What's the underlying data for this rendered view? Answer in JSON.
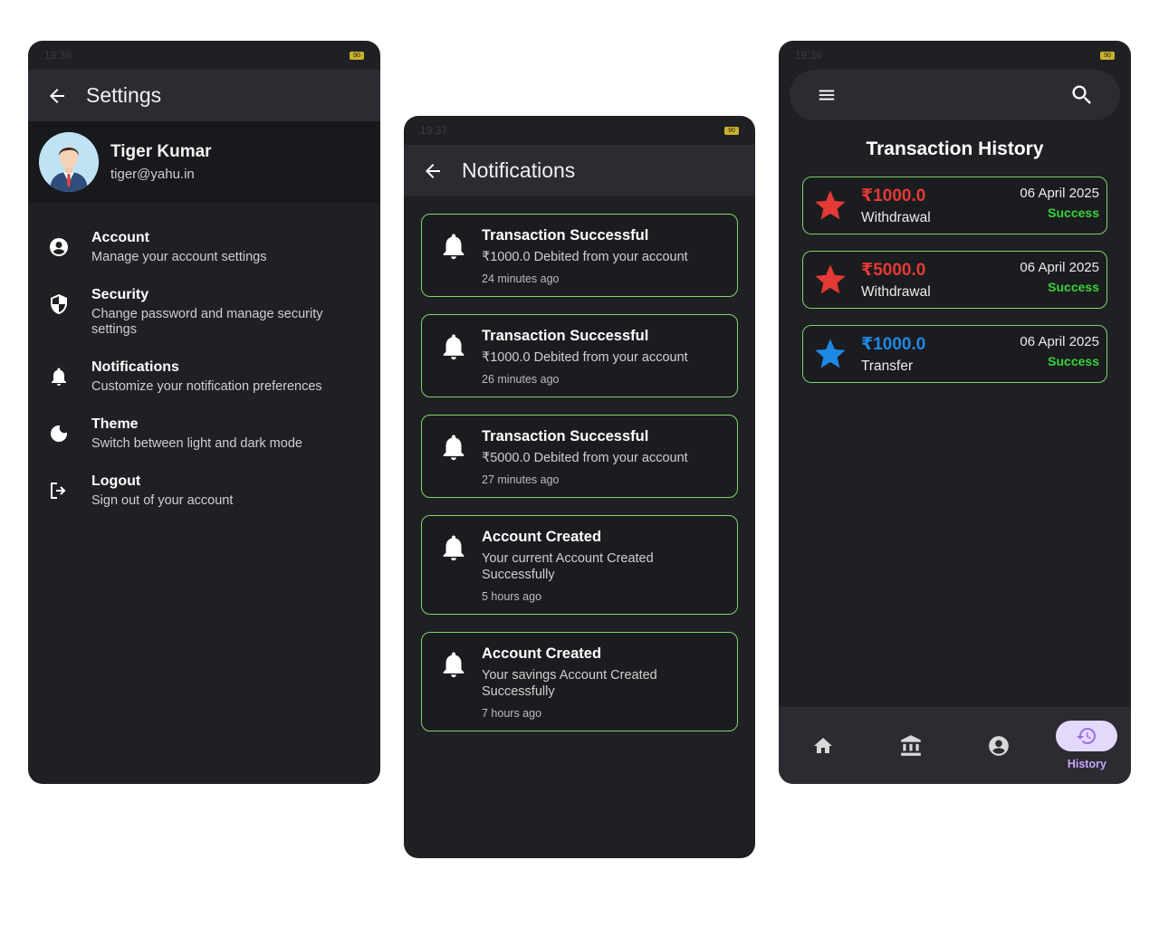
{
  "settings_screen": {
    "status": {
      "time": "19:36",
      "battery": "90"
    },
    "appbar_title": "Settings",
    "profile": {
      "name": "Tiger Kumar",
      "email": "tiger@yahu.in"
    },
    "items": [
      {
        "title": "Account",
        "subtitle": "Manage your account settings",
        "icon": "account-circle-icon"
      },
      {
        "title": "Security",
        "subtitle": "Change password and manage security settings",
        "icon": "shield-icon"
      },
      {
        "title": "Notifications",
        "subtitle": "Customize your notification preferences",
        "icon": "bell-icon"
      },
      {
        "title": "Theme",
        "subtitle": "Switch between light and dark mode",
        "icon": "moon-icon"
      },
      {
        "title": "Logout",
        "subtitle": "Sign out of your account",
        "icon": "logout-icon"
      }
    ]
  },
  "notifications_screen": {
    "status": {
      "time": "19:37",
      "battery": "90"
    },
    "appbar_title": "Notifications",
    "items": [
      {
        "title": "Transaction Successful",
        "message": "₹1000.0 Debited from your account",
        "time": "24 minutes ago"
      },
      {
        "title": "Transaction Successful",
        "message": "₹1000.0 Debited from your account",
        "time": "26 minutes ago"
      },
      {
        "title": "Transaction Successful",
        "message": "₹5000.0 Debited from your account",
        "time": "27 minutes ago"
      },
      {
        "title": "Account Created",
        "message": "Your current Account Created Successfully",
        "time": "5 hours ago"
      },
      {
        "title": "Account Created",
        "message": "Your savings Account Created Successfully",
        "time": "7 hours ago"
      }
    ]
  },
  "history_screen": {
    "status": {
      "time": "19:36",
      "battery": "90"
    },
    "title": "Transaction History",
    "transactions": [
      {
        "amount": "₹1000.0",
        "type": "Withdrawal",
        "date": "06 April 2025",
        "status": "Success",
        "color": "#e53935"
      },
      {
        "amount": "₹5000.0",
        "type": "Withdrawal",
        "date": "06 April 2025",
        "status": "Success",
        "color": "#e53935"
      },
      {
        "amount": "₹1000.0",
        "type": "Transfer",
        "date": "06 April 2025",
        "status": "Success",
        "color": "#1e88e5"
      }
    ],
    "nav": {
      "history_label": "History"
    },
    "colors": {
      "success": "#38d33a",
      "card_border": "#7fd36a",
      "nav_active": "#c9a6ff"
    }
  }
}
